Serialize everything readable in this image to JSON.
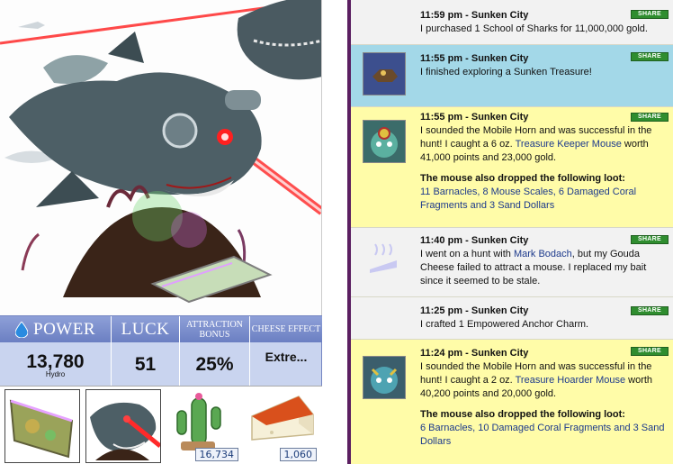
{
  "trap": {
    "stats": {
      "power_label": "POWER",
      "power_value": "13,780",
      "power_type": "Hydro",
      "luck_label": "LUCK",
      "luck_value": "51",
      "attraction_label": "ATTRACTION BONUS",
      "attraction_value": "25%",
      "cheese_effect_label": "CHEESE EFFECT",
      "cheese_effect_value": "Extre..."
    },
    "components": {
      "charm_quantity": "16,734",
      "cheese_quantity": "1,060"
    }
  },
  "journal": {
    "share_label": "SHARE",
    "entries": [
      {
        "title": "11:59 pm - Sunken City",
        "text": "I purchased 1 School of Sharks for 11,000,000 gold."
      },
      {
        "title": "11:55 pm - Sunken City",
        "text": "I finished exploring a Sunken Treasure!"
      },
      {
        "title": "11:55 pm - Sunken City",
        "text_before": "I sounded the Mobile Horn and was successful in the hunt! I caught a 6 oz. ",
        "mouse": "Treasure Keeper Mouse",
        "text_after": " worth 41,000 points and 23,000 gold.",
        "loot_heading": "The mouse also dropped the following loot:",
        "loot": "11 Barnacles, 8 Mouse Scales, 6 Damaged Coral Fragments and 3 Sand Dollars"
      },
      {
        "title": "11:40 pm - Sunken City",
        "text_before": "I went on a hunt with ",
        "hunter": "Mark Bodach",
        "text_after": ", but my Gouda Cheese failed to attract a mouse. I replaced my bait since it seemed to be stale."
      },
      {
        "title": "11:25 pm - Sunken City",
        "text": "I crafted 1 Empowered Anchor Charm."
      },
      {
        "title": "11:24 pm - Sunken City",
        "text_before": "I sounded the Mobile Horn and was successful in the hunt! I caught a 2 oz. ",
        "mouse": "Treasure Hoarder Mouse",
        "text_after": " worth 40,200 points and 20,000 gold.",
        "loot_heading": "The mouse also dropped the following loot:",
        "loot": "6 Barnacles, 10 Damaged Coral Fragments and 3 Sand Dollars"
      }
    ]
  },
  "colors": {
    "stats_header": "#7486c9",
    "journal_border": "#5b1f61",
    "entry_blue": "#a3d8e8",
    "entry_yellow": "#fffca8",
    "share_green": "#2f8d2f",
    "link": "#1d3a8c"
  }
}
